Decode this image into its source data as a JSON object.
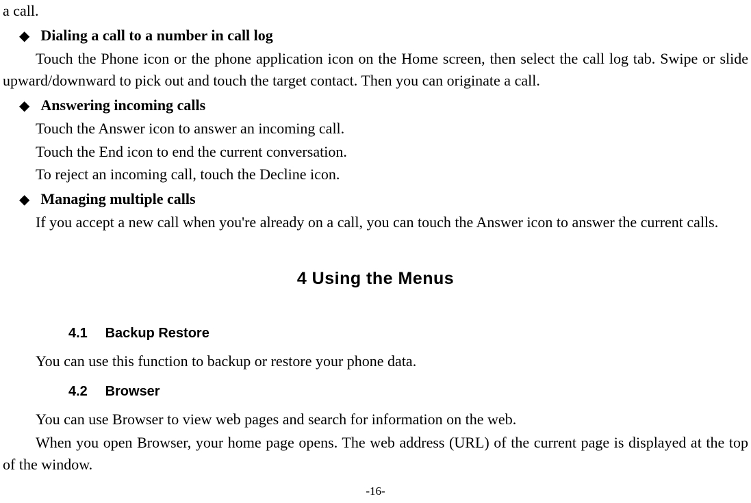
{
  "topFragment": "a call.",
  "bullets": {
    "b1": {
      "title": "Dialing a call to a number in call log",
      "para": "Touch the Phone icon or the phone application icon on the Home screen, then select the call log tab. Swipe or slide upward/downward to pick out and touch the target contact. Then you can originate a call."
    },
    "b2": {
      "title": "Answering incoming calls",
      "line1": "Touch the Answer icon to answer an incoming call.",
      "line2": "Touch the End icon to end the current conversation.",
      "line3": "To reject an incoming call, touch the Decline icon."
    },
    "b3": {
      "title": "Managing multiple calls",
      "para": "If you accept a new call when you're already on a call, you can touch the Answer icon to answer the current calls."
    }
  },
  "sectionTitle": "4 Using the Menus",
  "sub": {
    "s1": {
      "num": "4.1",
      "title": "Backup Restore",
      "para": "You can use this function to backup or restore your phone data."
    },
    "s2": {
      "num": "4.2",
      "title": "Browser",
      "line1": "You can use Browser to view web pages and search for information on the web.",
      "line2": "When you open Browser, your home page opens. The web address (URL) of the current page is displayed at the top of the window."
    }
  },
  "pageNumber": "-16-",
  "icons": {
    "diamond": "◆"
  }
}
